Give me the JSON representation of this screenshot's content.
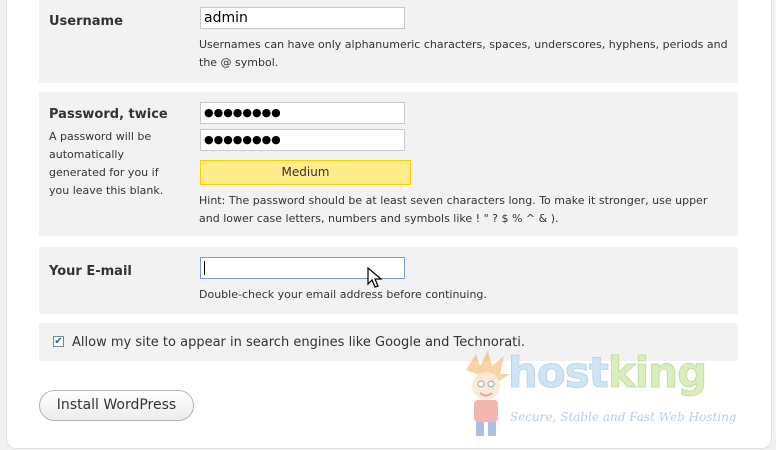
{
  "username": {
    "label": "Username",
    "value": "admin",
    "hint": "Usernames can have only alphanumeric characters, spaces, underscores, hyphens, periods and the @ symbol."
  },
  "password": {
    "label": "Password, twice",
    "description": "A password will be automatically generated for you if you leave this blank.",
    "value1": "●●●●●●●●",
    "value2": "●●●●●●●●",
    "strength": "Medium",
    "hint": "Hint: The password should be at least seven characters long. To make it stronger, use upper and lower case letters, numbers and symbols like ! \" ? $ % ^ & )."
  },
  "email": {
    "label": "Your E-mail",
    "value": "",
    "hint": "Double-check your email address before continuing."
  },
  "privacy": {
    "label": "Allow my site to appear in search engines like Google and Technorati.",
    "checked": true
  },
  "install_button": "Install WordPress",
  "watermark": {
    "brand_part1": "host",
    "brand_part2": "king",
    "tagline": "Secure, Stable and Fast Web Hosting"
  }
}
